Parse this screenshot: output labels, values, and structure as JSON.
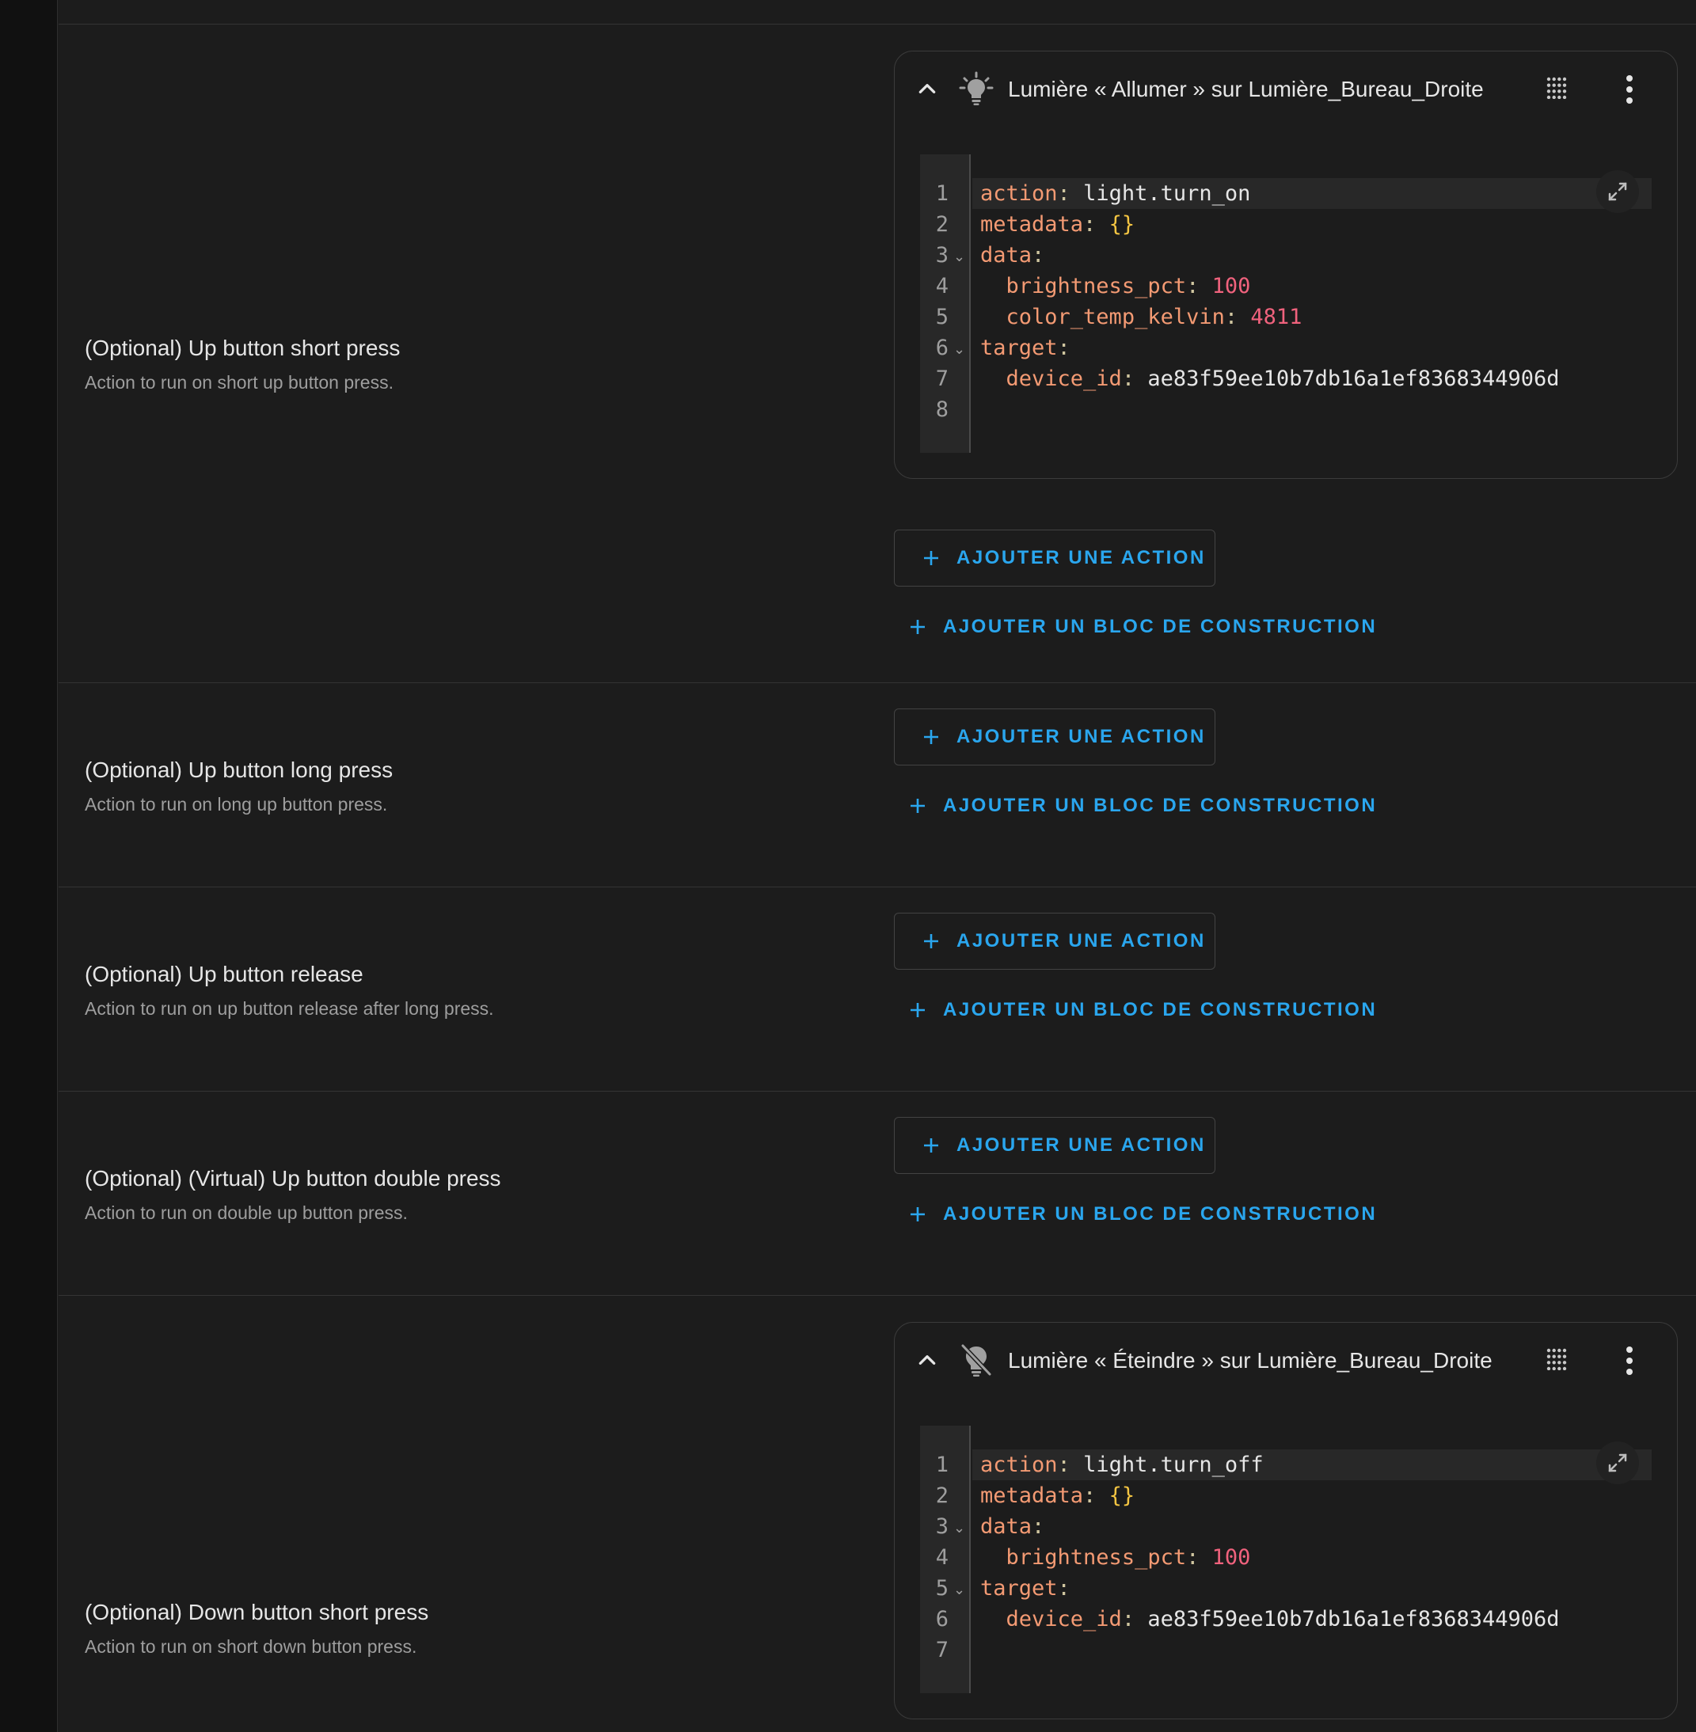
{
  "add_action_label": "AJOUTER UNE ACTION",
  "add_block_label": "AJOUTER UN BLOC DE CONSTRUCTION",
  "colors": {
    "background": "#1c1c1c",
    "accent": "#2aa6ee",
    "yaml_key": "#f39a73",
    "yaml_number": "#f0627d",
    "yaml_brace": "#f4c542"
  },
  "sections": [
    {
      "title": "(Optional) Up button short press",
      "description": "Action to run on short up button press.",
      "action": {
        "icon": "lightbulb-on-icon",
        "title": "Lumière « Allumer » sur Lumière_Bureau_Droite",
        "lines": [
          {
            "num": "1",
            "key": "action",
            "value": "light.turn_on"
          },
          {
            "num": "2",
            "key": "metadata",
            "value": "{}"
          },
          {
            "num": "3",
            "key": "data",
            "value": ""
          },
          {
            "num": "4",
            "key": "brightness_pct",
            "value": "100"
          },
          {
            "num": "5",
            "key": "color_temp_kelvin",
            "value": "4811"
          },
          {
            "num": "6",
            "key": "target",
            "value": ""
          },
          {
            "num": "7",
            "key": "device_id",
            "value": "ae83f59ee10b7db16a1ef8368344906d"
          },
          {
            "num": "8",
            "key": "",
            "value": ""
          }
        ]
      }
    },
    {
      "title": "(Optional) Up button long press",
      "description": "Action to run on long up button press."
    },
    {
      "title": "(Optional) Up button release",
      "description": "Action to run on up button release after long press."
    },
    {
      "title": "(Optional) (Virtual) Up button double press",
      "description": "Action to run on double up button press."
    },
    {
      "title": "(Optional) Down button short press",
      "description": "Action to run on short down button press.",
      "action": {
        "icon": "lightbulb-off-icon",
        "title": "Lumière « Éteindre » sur Lumière_Bureau_Droite",
        "lines": [
          {
            "num": "1",
            "key": "action",
            "value": "light.turn_off"
          },
          {
            "num": "2",
            "key": "metadata",
            "value": "{}"
          },
          {
            "num": "3",
            "key": "data",
            "value": ""
          },
          {
            "num": "4",
            "key": "brightness_pct",
            "value": "100"
          },
          {
            "num": "5",
            "key": "target",
            "value": ""
          },
          {
            "num": "6",
            "key": "device_id",
            "value": "ae83f59ee10b7db16a1ef8368344906d"
          },
          {
            "num": "7",
            "key": "",
            "value": ""
          }
        ]
      }
    }
  ]
}
